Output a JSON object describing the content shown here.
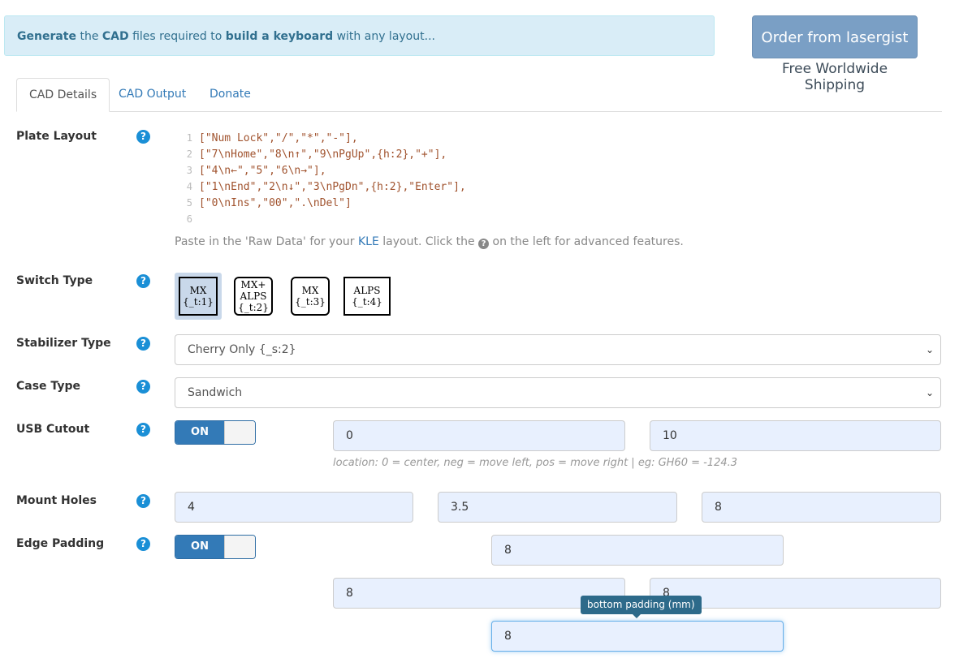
{
  "banner": {
    "w1": "Generate",
    "t1": " the ",
    "w2": "CAD",
    "t2": " files required to ",
    "w3": "build a keyboard",
    "t3": " with any layout..."
  },
  "order": {
    "button": "Order from lasergist",
    "shipping": "Free Worldwide Shipping"
  },
  "tabs": [
    "CAD Details",
    "CAD Output",
    "Donate"
  ],
  "plate": {
    "label": "Plate Layout",
    "lines": [
      "[\"Num Lock\",\"/\",\"*\",\"-\"],",
      "[\"7\\nHome\",\"8\\n↑\",\"9\\nPgUp\",{h:2},\"+\"],",
      "[\"4\\n←\",\"5\",\"6\\n→\"],",
      "[\"1\\nEnd\",\"2\\n↓\",\"3\\nPgDn\",{h:2},\"Enter\"],",
      "[\"0\\nIns\",\"00\",\".\\nDel\"]",
      ""
    ],
    "hint_a": "Paste in the 'Raw Data' for your ",
    "hint_link": "KLE",
    "hint_b": " layout. Click the ",
    "hint_c": " on the left for advanced features."
  },
  "switch": {
    "label": "Switch Type",
    "options": [
      {
        "line1": "MX",
        "line2": "{_t:1}",
        "line3": ""
      },
      {
        "line1": "MX+",
        "line2": "ALPS",
        "line3": "{_t:2}"
      },
      {
        "line1": "MX",
        "line2": "{_t:3}",
        "line3": ""
      },
      {
        "line1": "ALPS",
        "line2": "{_t:4}",
        "line3": ""
      }
    ]
  },
  "stabilizer": {
    "label": "Stabilizer Type",
    "value": "Cherry Only {_s:2}"
  },
  "case": {
    "label": "Case Type",
    "value": "Sandwich"
  },
  "usb": {
    "label": "USB Cutout",
    "toggle": "ON",
    "location": "0",
    "width": "10",
    "note": "location: 0 = center, neg = move left, pos = move right | eg: GH60 = -124.3"
  },
  "mount": {
    "label": "Mount Holes",
    "v1": "4",
    "v2": "3.5",
    "v3": "8"
  },
  "edge": {
    "label": "Edge Padding",
    "toggle": "ON",
    "top": "8",
    "left": "8",
    "right": "8",
    "bottom": "8",
    "tooltip": "bottom padding (mm)"
  },
  "help_glyph": "?"
}
